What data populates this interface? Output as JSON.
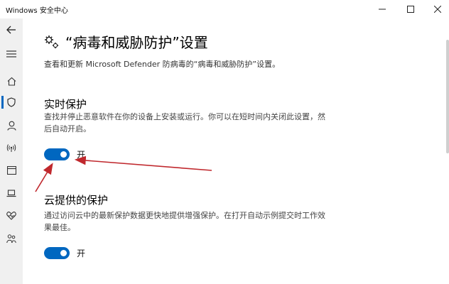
{
  "window": {
    "title": "Windows 安全中心",
    "minimize_icon": "minimize-icon",
    "maximize_icon": "maximize-icon",
    "close_icon": "close-icon"
  },
  "rail": {
    "items": [
      {
        "icon": "back-arrow-icon"
      },
      {
        "icon": "hamburger-menu-icon"
      },
      {
        "icon": "home-icon"
      },
      {
        "icon": "shield-icon",
        "active": true
      },
      {
        "icon": "person-icon"
      },
      {
        "icon": "wireless-icon"
      },
      {
        "icon": "app-browser-icon"
      },
      {
        "icon": "laptop-icon"
      },
      {
        "icon": "heart-icon"
      },
      {
        "icon": "family-icon"
      }
    ],
    "accent": "#0067c0"
  },
  "page": {
    "title": "“病毒和威胁防护”设置",
    "description": "查看和更新 Microsoft Defender 防病毒的“病毒和威胁防护”设置。"
  },
  "sections": [
    {
      "heading": "实时保护",
      "description": "查找并停止恶意软件在你的设备上安装或运行。你可以在短时间内关闭此设置，然后自动开启。",
      "toggle_label": "开",
      "toggle_on": true
    },
    {
      "heading": "云提供的保护",
      "description": "通过访问云中的最新保护数据更快地提供增强保护。在打开自动示例提交时工作效果最佳。",
      "toggle_label": "开",
      "toggle_on": true
    }
  ],
  "colors": {
    "accent": "#0067c0",
    "annotation_arrow": "#c0282d"
  }
}
